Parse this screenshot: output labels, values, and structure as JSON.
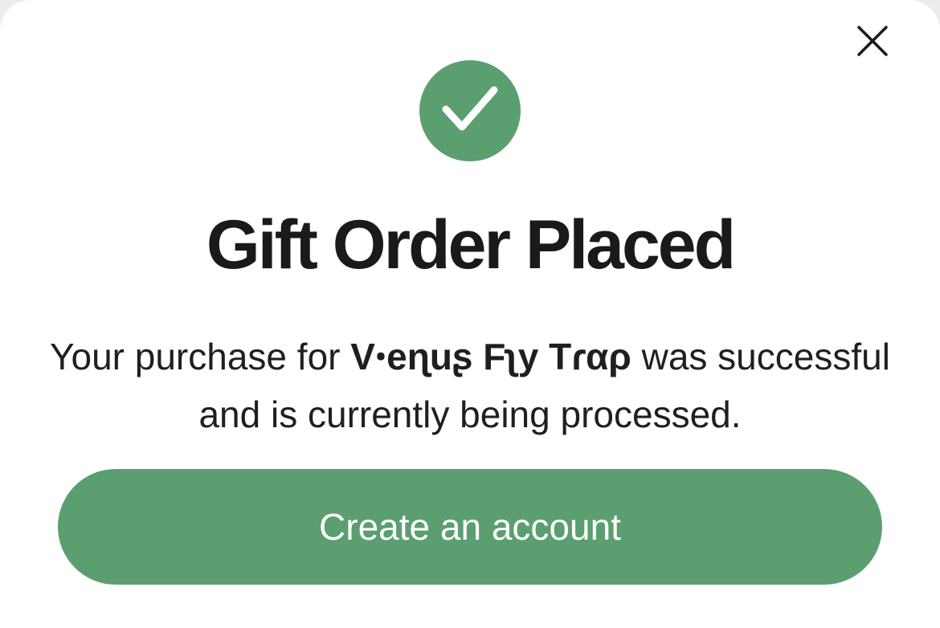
{
  "modal": {
    "close_icon": "close-icon",
    "success_icon": "checkmark-icon",
    "accent_color": "#5b9e70",
    "title": "Gift Order Placed",
    "message": {
      "prefix": "Your purchase for ",
      "product_name": "Vꞏeɳuʂ Fʅy Tɾαρ",
      "suffix": " was successful and is currently being processed."
    },
    "cta_label": "Create an account"
  }
}
